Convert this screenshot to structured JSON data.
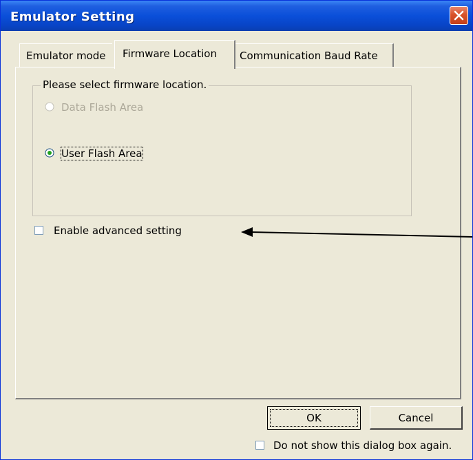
{
  "window": {
    "title": "Emulator Setting"
  },
  "tabs": [
    {
      "label": "Emulator mode",
      "selected": false
    },
    {
      "label": "Firmware Location",
      "selected": true
    },
    {
      "label": "Communication Baud Rate",
      "selected": false
    }
  ],
  "firmware_group": {
    "legend": "Please select firmware location.",
    "options": [
      {
        "label": "Data Flash Area",
        "enabled": false,
        "selected": false
      },
      {
        "label": "User Flash Area",
        "enabled": true,
        "selected": true
      }
    ]
  },
  "advanced": {
    "label": "Enable advanced setting",
    "checked": false
  },
  "buttons": {
    "ok": "OK",
    "cancel": "Cancel"
  },
  "footer": {
    "dont_show_label": "Do not show this dialog box again.",
    "checked": false
  },
  "colors": {
    "titlebar": "#0a4fd9",
    "dialog_bg": "#ece9d8",
    "close_button": "#d9522a",
    "disabled_text": "#aca899"
  }
}
